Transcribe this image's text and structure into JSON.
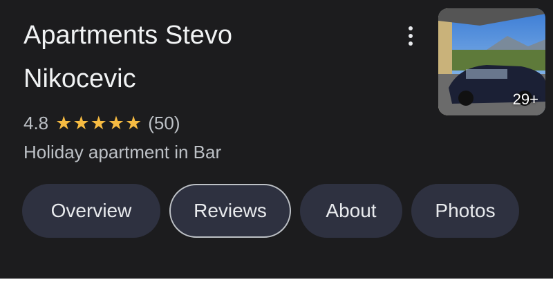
{
  "place": {
    "name_line1": "Apartments Stevo",
    "name_line2": "Nikocevic",
    "rating": "4.8",
    "rating_stars": 4.8,
    "review_count": "(50)",
    "category": "Holiday apartment in Bar"
  },
  "photo": {
    "count_label": "29+"
  },
  "icons": {
    "menu": "more-vert-icon",
    "star": "star-icon"
  },
  "tabs": [
    {
      "label": "Overview",
      "selected": false
    },
    {
      "label": "Reviews",
      "selected": true
    },
    {
      "label": "About",
      "selected": false
    },
    {
      "label": "Photos",
      "selected": false
    }
  ],
  "colors": {
    "background": "#1c1c1e",
    "star": "#f6bb42",
    "tab_bg": "#2e3140"
  }
}
